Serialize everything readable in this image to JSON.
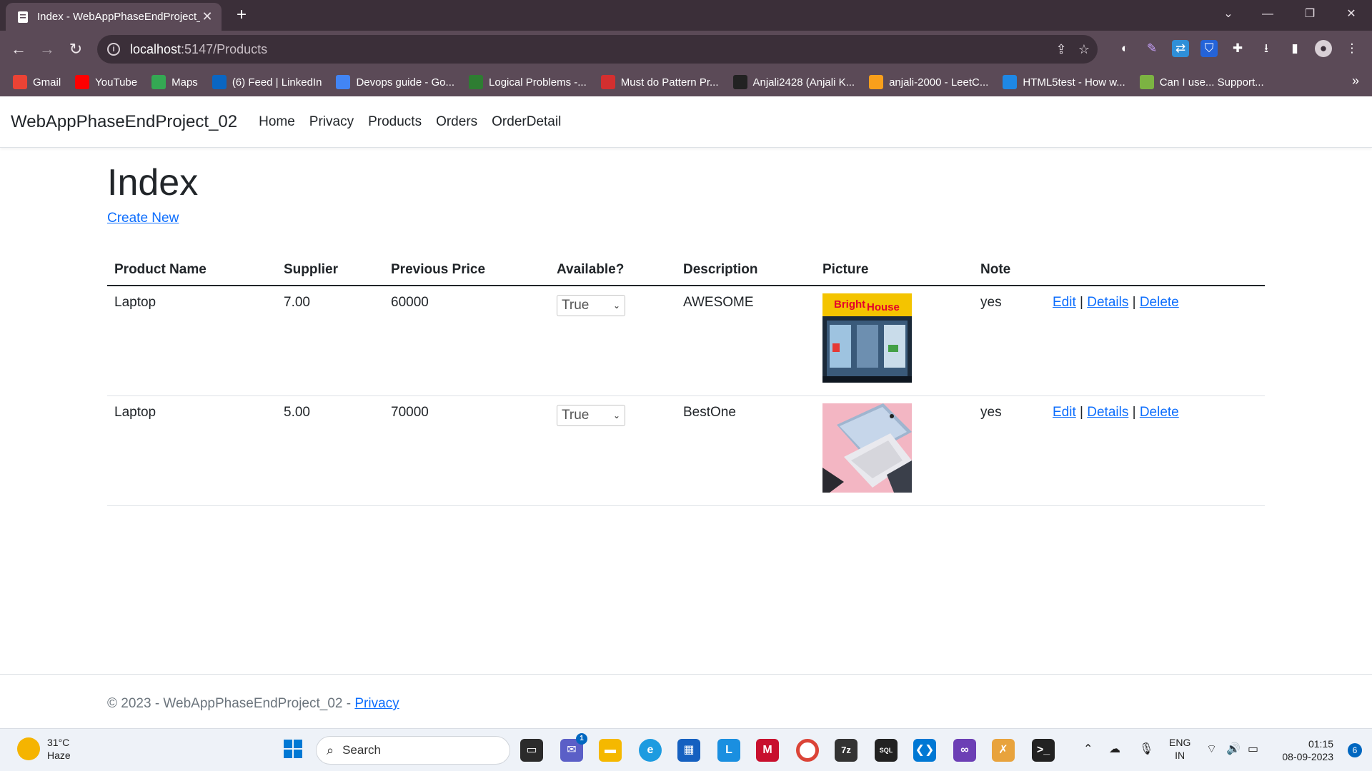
{
  "browser": {
    "tab_title": "Index - WebAppPhaseEndProject_02",
    "url_host": "localhost",
    "url_path": ":5147/Products",
    "bookmarks": [
      {
        "label": "Gmail",
        "icon": "gmail-icon",
        "color": "#ea4335"
      },
      {
        "label": "YouTube",
        "icon": "youtube-icon",
        "color": "#ff0000"
      },
      {
        "label": "Maps",
        "icon": "maps-icon",
        "color": "#34a853"
      },
      {
        "label": "(6) Feed | LinkedIn",
        "icon": "linkedin-icon",
        "color": "#0a66c2"
      },
      {
        "label": "Devops guide - Go...",
        "icon": "docs-icon",
        "color": "#4285f4"
      },
      {
        "label": "Logical Problems -...",
        "icon": "logical-icon",
        "color": "#2e7d32"
      },
      {
        "label": "Must do Pattern Pr...",
        "icon": "tuf-icon",
        "color": "#d32f2f"
      },
      {
        "label": "Anjali2428 (Anjali K...",
        "icon": "github-icon",
        "color": "#222222"
      },
      {
        "label": "anjali-2000 - LeetC...",
        "icon": "leetcode-icon",
        "color": "#f89f1b"
      },
      {
        "label": "HTML5test - How w...",
        "icon": "html5-icon",
        "color": "#1e88e5"
      },
      {
        "label": "Can I use... Support...",
        "icon": "caniuse-icon",
        "color": "#7cb342"
      }
    ]
  },
  "app": {
    "brand": "WebAppPhaseEndProject_02",
    "nav": [
      "Home",
      "Privacy",
      "Products",
      "Orders",
      "OrderDetail"
    ],
    "heading": "Index",
    "create_new": "Create New",
    "columns": [
      "Product Name",
      "Supplier",
      "Previous Price",
      "Available?",
      "Description",
      "Picture",
      "Note"
    ],
    "rows": [
      {
        "name": "Laptop",
        "supplier": "7.00",
        "price": "60000",
        "available": "True",
        "description": "AWESOME",
        "picture": "brighthouse-store-photo",
        "note": "yes"
      },
      {
        "name": "Laptop",
        "supplier": "5.00",
        "price": "70000",
        "available": "True",
        "description": "BestOne",
        "picture": "laptop-pink-photo",
        "note": "yes"
      }
    ],
    "actions": {
      "edit": "Edit",
      "details": "Details",
      "delete": "Delete",
      "sep": "|"
    },
    "footer": {
      "text": "© 2023 - WebAppPhaseEndProject_02 - ",
      "link": "Privacy"
    },
    "colors": {
      "link": "#0d6efd",
      "text": "#212529",
      "muted": "#6c757d"
    }
  },
  "taskbar": {
    "temp": "31°C",
    "weather": "Haze",
    "search": "Search",
    "chat_badge": "1",
    "lang1": "ENG",
    "lang2": "IN",
    "time": "01:15",
    "date": "08-09-2023",
    "notifications": "6"
  }
}
